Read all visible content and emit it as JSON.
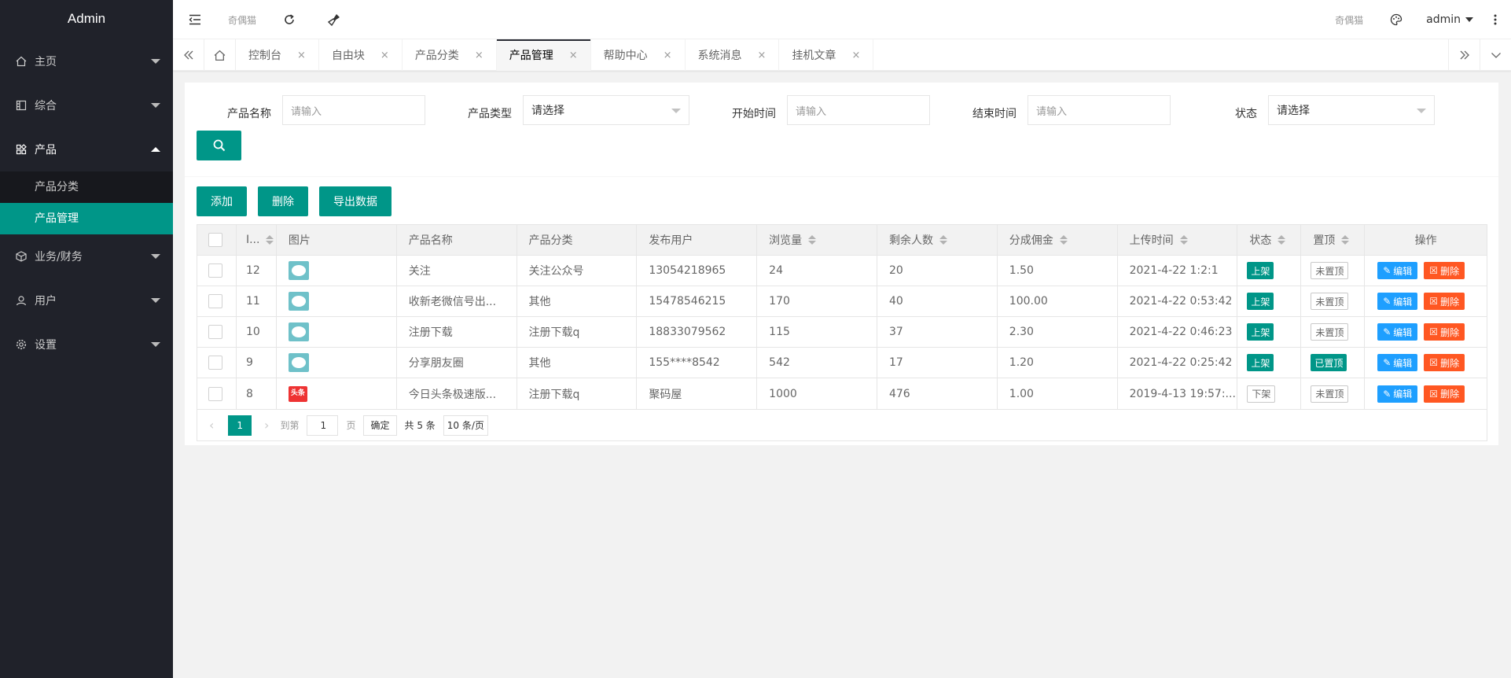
{
  "sidebar": {
    "logo": "Admin",
    "items": [
      {
        "label": "主页",
        "icon": "home-icon"
      },
      {
        "label": "综合",
        "icon": "grid-icon"
      },
      {
        "label": "产品",
        "icon": "apps-icon",
        "sub": [
          {
            "label": "产品分类"
          },
          {
            "label": "产品管理"
          }
        ]
      },
      {
        "label": "业务/财务",
        "icon": "box-icon"
      },
      {
        "label": "用户",
        "icon": "user-icon"
      },
      {
        "label": "设置",
        "icon": "settings-icon"
      }
    ]
  },
  "topbar": {
    "left_text": "奇偶猫",
    "right_text": "奇偶猫",
    "user": "admin"
  },
  "tabs": [
    {
      "label": "控制台",
      "active": false
    },
    {
      "label": "自由块",
      "active": false
    },
    {
      "label": "产品分类",
      "active": false
    },
    {
      "label": "产品管理",
      "active": true
    },
    {
      "label": "帮助中心",
      "active": false
    },
    {
      "label": "系统消息",
      "active": false
    },
    {
      "label": "挂机文章",
      "active": false
    }
  ],
  "tab_close": "×",
  "search": {
    "name_label": "产品名称",
    "name_placeholder": "请输入",
    "type_label": "产品类型",
    "type_value": "请选择",
    "start_label": "开始时间",
    "start_placeholder": "请输入",
    "end_label": "结束时间",
    "end_placeholder": "请输入",
    "status_label": "状态",
    "status_value": "请选择"
  },
  "toolbar": {
    "add": "添加",
    "delete": "删除",
    "export": "导出数据"
  },
  "table": {
    "headers": [
      "I...",
      "图片",
      "产品名称",
      "产品分类",
      "发布用户",
      "浏览量",
      "剩余人数",
      "分成佣金",
      "上传时间",
      "状态",
      "置顶",
      "操作"
    ],
    "rows": [
      {
        "id": "12",
        "img": "chat",
        "name": "关注",
        "category": "关注公众号",
        "user": "13054218965",
        "views": "24",
        "remaining": "20",
        "commission": "1.50",
        "time": "2021-4-22 1:2:1",
        "status": "上架",
        "top": "未置顶"
      },
      {
        "id": "11",
        "img": "chat",
        "name": "收新老微信号出...",
        "category": "其他",
        "user": "15478546215",
        "views": "170",
        "remaining": "40",
        "commission": "100.00",
        "time": "2021-4-22 0:53:42",
        "status": "上架",
        "top": "未置顶"
      },
      {
        "id": "10",
        "img": "chat",
        "name": "注册下载",
        "category": "注册下载q",
        "user": "18833079562",
        "views": "115",
        "remaining": "37",
        "commission": "2.30",
        "time": "2021-4-22 0:46:23",
        "status": "上架",
        "top": "未置顶"
      },
      {
        "id": "9",
        "img": "chat",
        "name": "分享朋友圈",
        "category": "其他",
        "user": "155****8542",
        "views": "542",
        "remaining": "17",
        "commission": "1.20",
        "time": "2021-4-22 0:25:42",
        "status": "上架",
        "top": "已置顶"
      },
      {
        "id": "8",
        "img": "toutiao",
        "img_text": "头条",
        "name": "今日头条极速版...",
        "category": "注册下载q",
        "user": "聚码屋",
        "views": "1000",
        "remaining": "476",
        "commission": "1.00",
        "time": "2019-4-13 19:57:...",
        "status": "下架",
        "top": "未置顶"
      }
    ],
    "edit_label": "编辑",
    "delete_label": "删除"
  },
  "pager": {
    "current": "1",
    "goto_label": "到第",
    "page_value": "1",
    "page_unit": "页",
    "confirm": "确定",
    "total": "共 5 条",
    "per_page": "10 条/页"
  },
  "colors": {
    "primary": "#009688",
    "sidebar": "#20222a",
    "blue": "#1e9fff",
    "red": "#ff5722"
  }
}
